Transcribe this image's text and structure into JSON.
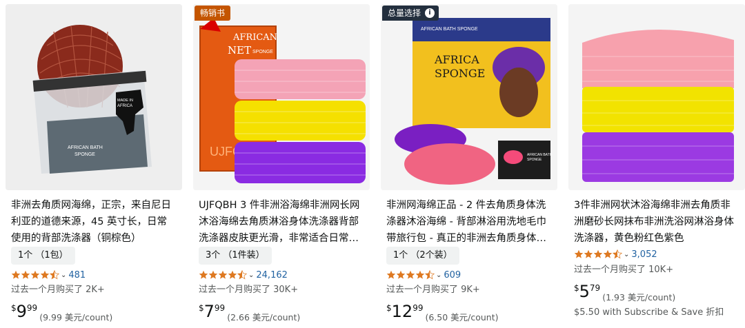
{
  "products": [
    {
      "badge": "",
      "title": "非洲去角质网海绵，正宗，来自尼日利亚的道德来源，45 英寸长，日常使用的背部洗涤器（铜棕色）",
      "variant": "1个 （1包）",
      "rating": 4.5,
      "reviews": "481",
      "bought": "过去一个月购买了 2K+",
      "price_symbol": "$",
      "price_whole": "9",
      "price_fraction": "99",
      "unit_price": "(9.99 美元/count)",
      "image_label_1": "MADE IN AFRICA",
      "image_label_2": "AFRICAN BATH SPONGE"
    },
    {
      "badge": "畅销书",
      "title": "UJFQBH 3 件非洲浴海绵非洲网长网沐浴海绵去角质淋浴身体洗涤器背部洗涤器皮肤更光滑，非常适合日常…",
      "variant": "3个 （1件装）",
      "rating": 4.5,
      "reviews": "24,162",
      "bought": "过去一个月购买了 30K+",
      "price_symbol": "$",
      "price_whole": "7",
      "price_fraction": "99",
      "unit_price": "(2.66 美元/count)",
      "image_label_1": "AFRICAN",
      "image_label_2": "NET",
      "image_label_3": "SPONGE",
      "image_label_4": "UJFQ"
    },
    {
      "badge": "总量选择",
      "title": "非洲网海绵正品 - 2 件去角质身体洗涤器沐浴海绵 - 背部淋浴用洗地毛巾带旅行包 - 真正的非洲去角质身体…",
      "variant": "1个 （2个装）",
      "rating": 4.5,
      "reviews": "609",
      "bought": "过去一个月购买了 9K+",
      "price_symbol": "$",
      "price_whole": "12",
      "price_fraction": "99",
      "unit_price": "(6.50 美元/count)",
      "image_label_1": "AFRICAN BATH SPONGE",
      "image_label_2": "AFRICA",
      "image_label_3": "SPONGE",
      "image_label_4": "AFRICAN BATH SPONGE"
    },
    {
      "badge": "",
      "title": "3件非洲网状沐浴海绵非洲去角质非洲磨砂长网抹布非洲洗浴网淋浴身体洗涤器，黄色粉红色紫色",
      "variant": "",
      "rating": 4.5,
      "reviews": "3,052",
      "bought": "过去一个月购买了 10K+",
      "price_symbol": "$",
      "price_whole": "5",
      "price_fraction": "79",
      "unit_price": "(1.93 美元/count)",
      "subscribe": "$5.50 with Subscribe & Save 折扣"
    }
  ],
  "colors": {
    "star": "#de7921",
    "link": "#2162a1",
    "best_seller_badge": "#c45500",
    "overall_pick_badge": "#232f3e"
  },
  "icons": {
    "info": "i",
    "chevron": "chevron-down"
  }
}
